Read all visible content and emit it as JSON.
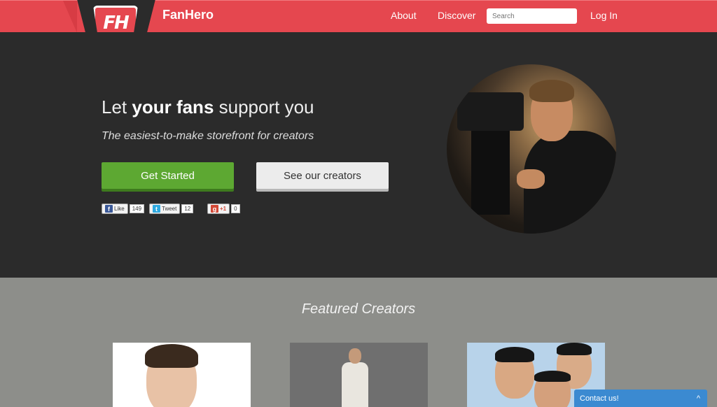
{
  "header": {
    "logo_text": "FH",
    "brand": "FanHero",
    "nav": {
      "about": "About",
      "discover": "Discover",
      "login": "Log In"
    },
    "search_placeholder": "Search"
  },
  "hero": {
    "headline_pre": "Let ",
    "headline_bold": "your fans",
    "headline_post": " support you",
    "subhead": "The easiest-to-make storefront for creators",
    "primary_button": "Get Started",
    "secondary_button": "See our creators",
    "social": {
      "like_label": "Like",
      "like_count": "149",
      "tweet_label": "Tweet",
      "tweet_count": "12",
      "plus_label": "+1",
      "plus_count": "0"
    }
  },
  "featured": {
    "title": "Featured Creators"
  },
  "contact": {
    "label": "Contact us!",
    "chevron": "^"
  },
  "colors": {
    "brand_red": "#e5474f",
    "hero_bg": "#2b2b2b",
    "cta_green": "#5da832",
    "featured_bg": "#8d8e8a",
    "contact_blue": "#3b8ad1"
  }
}
